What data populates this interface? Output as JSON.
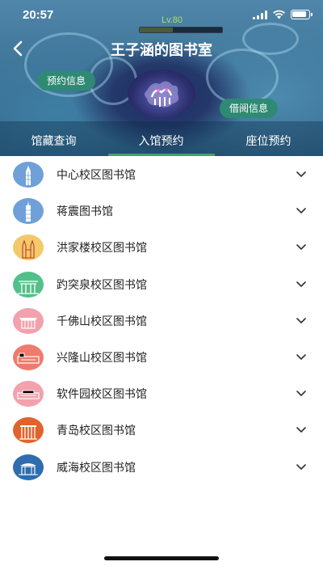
{
  "status_bar": {
    "time": "20:57"
  },
  "header": {
    "level": "Lv.80",
    "title": "王子涵的图书室",
    "reservation_info": "预约信息",
    "borrow_info": "借阅信息"
  },
  "tabs": [
    {
      "label": "馆藏查询",
      "active": false
    },
    {
      "label": "入馆预约",
      "active": true
    },
    {
      "label": "座位预约",
      "active": false
    }
  ],
  "colors": {
    "accent_green": "#3fa36a",
    "pill_green": "#2f8a74"
  },
  "libraries": [
    {
      "name": "中心校区图书馆",
      "icon": "tower-building-icon",
      "icon_bg": "#6fa1d8"
    },
    {
      "name": "蒋震图书馆",
      "icon": "tower-building-icon",
      "icon_bg": "#6fa1d8"
    },
    {
      "name": "洪家楼校区图书馆",
      "icon": "church-icon",
      "icon_bg": "#f3c96a"
    },
    {
      "name": "趵突泉校区图书馆",
      "icon": "gate-icon",
      "icon_bg": "#52c08a"
    },
    {
      "name": "千佛山校区图书馆",
      "icon": "hall-icon",
      "icon_bg": "#f2a1ad"
    },
    {
      "name": "兴隆山校区图书馆",
      "icon": "long-building-icon",
      "icon_bg": "#ee7b6d"
    },
    {
      "name": "软件园校区图书馆",
      "icon": "long-building-icon",
      "icon_bg": "#f2a1ad"
    },
    {
      "name": "青岛校区图书馆",
      "icon": "colonnade-icon",
      "icon_bg": "#e2622d"
    },
    {
      "name": "威海校区图书馆",
      "icon": "pavilion-icon",
      "icon_bg": "#2d6db0"
    }
  ]
}
